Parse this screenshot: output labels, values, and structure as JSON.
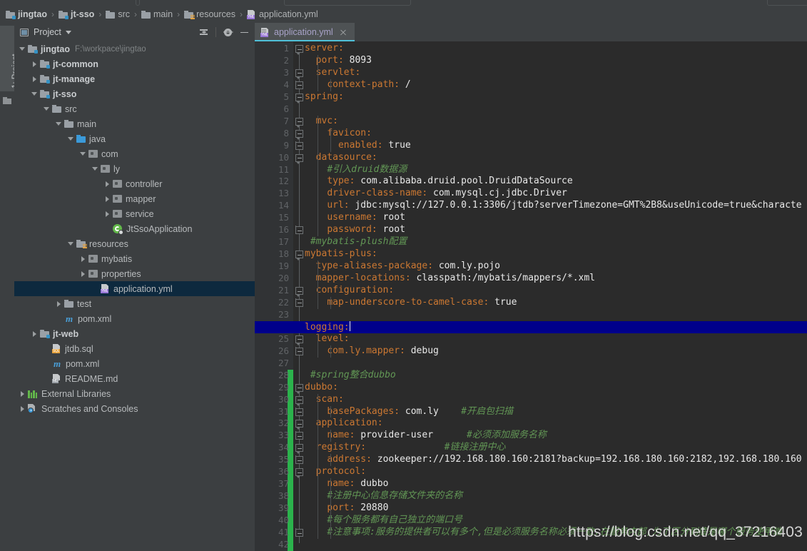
{
  "breadcrumb": {
    "items": [
      {
        "label": "jingtao",
        "icon": "module-folder-icon",
        "bold": true
      },
      {
        "label": "jt-sso",
        "icon": "module-folder-icon",
        "bold": true
      },
      {
        "label": "src",
        "icon": "folder-icon",
        "bold": false
      },
      {
        "label": "main",
        "icon": "folder-icon",
        "bold": false
      },
      {
        "label": "resources",
        "icon": "resources-folder-icon",
        "bold": false
      },
      {
        "label": "application.yml",
        "icon": "yml-file-icon",
        "bold": false
      }
    ],
    "separator": "›"
  },
  "left_strip": {
    "project_tab_label": "1: Project"
  },
  "project_panel": {
    "title": "Project",
    "icons": [
      "collapse-all-icon",
      "settings-gear-icon",
      "minimize-icon"
    ],
    "tree": [
      {
        "label": "jingtao",
        "path": "F:\\workpace\\jingtao",
        "depth": 0,
        "arrow": "down",
        "icon": "module-folder-icon",
        "bold": true,
        "selected": false
      },
      {
        "label": "jt-common",
        "path": "",
        "depth": 1,
        "arrow": "right",
        "icon": "module-folder-icon",
        "bold": true,
        "selected": false
      },
      {
        "label": "jt-manage",
        "path": "",
        "depth": 1,
        "arrow": "right",
        "icon": "module-folder-icon",
        "bold": true,
        "selected": false
      },
      {
        "label": "jt-sso",
        "path": "",
        "depth": 1,
        "arrow": "down",
        "icon": "module-folder-icon",
        "bold": true,
        "selected": false
      },
      {
        "label": "src",
        "path": "",
        "depth": 2,
        "arrow": "down",
        "icon": "folder-icon",
        "bold": false,
        "selected": false
      },
      {
        "label": "main",
        "path": "",
        "depth": 3,
        "arrow": "down",
        "icon": "folder-icon",
        "bold": false,
        "selected": false
      },
      {
        "label": "java",
        "path": "",
        "depth": 4,
        "arrow": "down",
        "icon": "source-folder-icon",
        "bold": false,
        "selected": false
      },
      {
        "label": "com",
        "path": "",
        "depth": 5,
        "arrow": "down",
        "icon": "package-icon",
        "bold": false,
        "selected": false
      },
      {
        "label": "ly",
        "path": "",
        "depth": 6,
        "arrow": "down",
        "icon": "package-icon",
        "bold": false,
        "selected": false
      },
      {
        "label": "controller",
        "path": "",
        "depth": 7,
        "arrow": "right",
        "icon": "package-icon",
        "bold": false,
        "selected": false
      },
      {
        "label": "mapper",
        "path": "",
        "depth": 7,
        "arrow": "right",
        "icon": "package-icon",
        "bold": false,
        "selected": false
      },
      {
        "label": "service",
        "path": "",
        "depth": 7,
        "arrow": "right",
        "icon": "package-icon",
        "bold": false,
        "selected": false
      },
      {
        "label": "JtSsoApplication",
        "path": "",
        "depth": 7,
        "arrow": "none",
        "icon": "spring-boot-class-icon",
        "bold": false,
        "selected": false
      },
      {
        "label": "resources",
        "path": "",
        "depth": 4,
        "arrow": "down",
        "icon": "resources-folder-icon",
        "bold": false,
        "selected": false
      },
      {
        "label": "mybatis",
        "path": "",
        "depth": 5,
        "arrow": "right",
        "icon": "package-icon",
        "bold": false,
        "selected": false
      },
      {
        "label": "properties",
        "path": "",
        "depth": 5,
        "arrow": "right",
        "icon": "package-icon",
        "bold": false,
        "selected": false
      },
      {
        "label": "application.yml",
        "path": "",
        "depth": 6,
        "arrow": "none",
        "icon": "yml-file-icon",
        "bold": false,
        "selected": true
      },
      {
        "label": "test",
        "path": "",
        "depth": 3,
        "arrow": "right",
        "icon": "folder-icon",
        "bold": false,
        "selected": false
      },
      {
        "label": "pom.xml",
        "path": "",
        "depth": 3,
        "arrow": "none",
        "icon": "maven-icon",
        "bold": false,
        "selected": false
      },
      {
        "label": "jt-web",
        "path": "",
        "depth": 1,
        "arrow": "right",
        "icon": "module-folder-icon",
        "bold": true,
        "selected": false
      },
      {
        "label": "jtdb.sql",
        "path": "",
        "depth": 2,
        "arrow": "none",
        "icon": "sql-file-icon",
        "bold": false,
        "selected": false
      },
      {
        "label": "pom.xml",
        "path": "",
        "depth": 2,
        "arrow": "none",
        "icon": "maven-icon",
        "bold": false,
        "selected": false
      },
      {
        "label": "README.md",
        "path": "",
        "depth": 2,
        "arrow": "none",
        "icon": "md-file-icon",
        "bold": false,
        "selected": false
      },
      {
        "label": "External Libraries",
        "path": "",
        "depth": 0,
        "arrow": "right",
        "icon": "libraries-icon",
        "bold": false,
        "selected": false
      },
      {
        "label": "Scratches and Consoles",
        "path": "",
        "depth": 0,
        "arrow": "right",
        "icon": "scratches-icon",
        "bold": false,
        "selected": false
      }
    ]
  },
  "editor": {
    "tab": {
      "label": "application.yml",
      "icon": "yml-file-icon",
      "close_icon": "close-icon",
      "active": true
    },
    "current_line": 24,
    "total_rendered_lines": 42,
    "colors": {
      "background": "#2b2b2b",
      "gutter": "#313335",
      "key": "#cc7832",
      "value": "#e8e8e8",
      "comment": "#629755",
      "current_line_bg": "#00008b",
      "vcs_added": "#2bb24c",
      "tab_underline": "#4fc0d8"
    },
    "vcs_marker_lines": [
      28,
      29,
      30,
      31,
      32,
      33,
      34,
      35,
      36,
      37,
      38,
      39,
      40,
      41,
      42
    ],
    "lines": [
      {
        "n": 1,
        "indent": 0,
        "fold": "top",
        "segs": [
          {
            "t": "server:",
            "c": "k"
          }
        ]
      },
      {
        "n": 2,
        "indent": 1,
        "fold": "none",
        "segs": [
          {
            "t": "port: ",
            "c": "k"
          },
          {
            "t": "8093",
            "c": "v"
          }
        ]
      },
      {
        "n": 3,
        "indent": 1,
        "fold": "top",
        "segs": [
          {
            "t": "servlet:",
            "c": "k"
          }
        ]
      },
      {
        "n": 4,
        "indent": 2,
        "fold": "end",
        "segs": [
          {
            "t": "context-path: ",
            "c": "k"
          },
          {
            "t": "/",
            "c": "v"
          }
        ]
      },
      {
        "n": 5,
        "indent": 0,
        "fold": "top",
        "segs": [
          {
            "t": "spring:",
            "c": "k"
          }
        ]
      },
      {
        "n": 6,
        "indent": 0,
        "fold": "none",
        "segs": []
      },
      {
        "n": 7,
        "indent": 1,
        "fold": "top",
        "segs": [
          {
            "t": "mvc:",
            "c": "k"
          }
        ]
      },
      {
        "n": 8,
        "indent": 2,
        "fold": "top",
        "segs": [
          {
            "t": "favicon:",
            "c": "k"
          }
        ]
      },
      {
        "n": 9,
        "indent": 3,
        "fold": "end",
        "segs": [
          {
            "t": "enabled: ",
            "c": "k"
          },
          {
            "t": "true",
            "c": "v"
          }
        ]
      },
      {
        "n": 10,
        "indent": 1,
        "fold": "top",
        "segs": [
          {
            "t": "datasource:",
            "c": "k"
          }
        ]
      },
      {
        "n": 11,
        "indent": 2,
        "fold": "none",
        "segs": [
          {
            "t": "#引入druid数据源",
            "c": "cm"
          }
        ]
      },
      {
        "n": 12,
        "indent": 2,
        "fold": "none",
        "segs": [
          {
            "t": "type: ",
            "c": "k"
          },
          {
            "t": "com.alibaba.druid.pool.DruidDataSource",
            "c": "v"
          }
        ]
      },
      {
        "n": 13,
        "indent": 2,
        "fold": "none",
        "segs": [
          {
            "t": "driver-class-name: ",
            "c": "k"
          },
          {
            "t": "com.mysql.cj.jdbc.Driver",
            "c": "v"
          }
        ]
      },
      {
        "n": 14,
        "indent": 2,
        "fold": "none",
        "segs": [
          {
            "t": "url: ",
            "c": "k"
          },
          {
            "t": "jdbc:mysql://127.0.0.1:3306/jtdb?serverTimezone=GMT%2B8&useUnicode=true&characte",
            "c": "v"
          }
        ]
      },
      {
        "n": 15,
        "indent": 2,
        "fold": "none",
        "segs": [
          {
            "t": "username: ",
            "c": "k"
          },
          {
            "t": "root",
            "c": "v"
          }
        ]
      },
      {
        "n": 16,
        "indent": 2,
        "fold": "end",
        "segs": [
          {
            "t": "password: ",
            "c": "k"
          },
          {
            "t": "root",
            "c": "v"
          }
        ]
      },
      {
        "n": 17,
        "indent": 0,
        "fold": "none",
        "segs": [
          {
            "t": " #mybatis-plush配置",
            "c": "cm"
          }
        ]
      },
      {
        "n": 18,
        "indent": 0,
        "fold": "top",
        "segs": [
          {
            "t": "mybatis-plus:",
            "c": "k"
          }
        ]
      },
      {
        "n": 19,
        "indent": 1,
        "fold": "none",
        "segs": [
          {
            "t": "type-aliases-package: ",
            "c": "k"
          },
          {
            "t": "com.ly.pojo",
            "c": "v"
          }
        ]
      },
      {
        "n": 20,
        "indent": 1,
        "fold": "none",
        "segs": [
          {
            "t": "mapper-locations: ",
            "c": "k"
          },
          {
            "t": "classpath:/mybatis/mappers/*.xml",
            "c": "v"
          }
        ]
      },
      {
        "n": 21,
        "indent": 1,
        "fold": "top",
        "segs": [
          {
            "t": "configuration:",
            "c": "k"
          }
        ]
      },
      {
        "n": 22,
        "indent": 2,
        "fold": "end",
        "segs": [
          {
            "t": "map-underscore-to-camel-case: ",
            "c": "k"
          },
          {
            "t": "true",
            "c": "v"
          }
        ]
      },
      {
        "n": 23,
        "indent": 0,
        "fold": "none",
        "segs": []
      },
      {
        "n": 24,
        "indent": 0,
        "fold": "top",
        "segs": [
          {
            "t": "logging:",
            "c": "k"
          }
        ],
        "caret": true
      },
      {
        "n": 25,
        "indent": 1,
        "fold": "top",
        "segs": [
          {
            "t": "level:",
            "c": "k"
          }
        ]
      },
      {
        "n": 26,
        "indent": 2,
        "fold": "end",
        "segs": [
          {
            "t": "com.ly.mapper: ",
            "c": "k"
          },
          {
            "t": "debug",
            "c": "v"
          }
        ]
      },
      {
        "n": 27,
        "indent": 0,
        "fold": "none",
        "segs": []
      },
      {
        "n": 28,
        "indent": 0,
        "fold": "none",
        "segs": [
          {
            "t": " #spring整合dubbo",
            "c": "cm"
          }
        ]
      },
      {
        "n": 29,
        "indent": 0,
        "fold": "top",
        "segs": [
          {
            "t": "dubbo:",
            "c": "k"
          }
        ]
      },
      {
        "n": 30,
        "indent": 1,
        "fold": "top",
        "segs": [
          {
            "t": "scan:",
            "c": "k"
          }
        ]
      },
      {
        "n": 31,
        "indent": 2,
        "fold": "end",
        "segs": [
          {
            "t": "basePackages: ",
            "c": "k"
          },
          {
            "t": "com.ly",
            "c": "v"
          },
          {
            "t": "    #开启包扫描",
            "c": "cm"
          }
        ]
      },
      {
        "n": 32,
        "indent": 1,
        "fold": "top",
        "segs": [
          {
            "t": "application:",
            "c": "k"
          }
        ]
      },
      {
        "n": 33,
        "indent": 2,
        "fold": "end",
        "segs": [
          {
            "t": "name: ",
            "c": "k"
          },
          {
            "t": "provider-user",
            "c": "v"
          },
          {
            "t": "      #必须添加服务名称",
            "c": "cm"
          }
        ]
      },
      {
        "n": 34,
        "indent": 1,
        "fold": "top",
        "segs": [
          {
            "t": "registry:",
            "c": "k"
          },
          {
            "t": "              #链接注册中心",
            "c": "cm"
          }
        ]
      },
      {
        "n": 35,
        "indent": 2,
        "fold": "end",
        "segs": [
          {
            "t": "address: ",
            "c": "k"
          },
          {
            "t": "zookeeper://192.168.180.160:2181?backup=192.168.180.160:2182,192.168.180.160",
            "c": "v"
          }
        ]
      },
      {
        "n": 36,
        "indent": 1,
        "fold": "top",
        "segs": [
          {
            "t": "protocol:",
            "c": "k"
          }
        ]
      },
      {
        "n": 37,
        "indent": 2,
        "fold": "none",
        "segs": [
          {
            "t": "name: ",
            "c": "k"
          },
          {
            "t": "dubbo",
            "c": "v"
          }
        ]
      },
      {
        "n": 38,
        "indent": 2,
        "fold": "none",
        "segs": [
          {
            "t": "#注册中心信息存储文件夹的名称",
            "c": "cm"
          }
        ]
      },
      {
        "n": 39,
        "indent": 2,
        "fold": "none",
        "segs": [
          {
            "t": "port: ",
            "c": "k"
          },
          {
            "t": "20880",
            "c": "v"
          }
        ]
      },
      {
        "n": 40,
        "indent": 2,
        "fold": "none",
        "segs": [
          {
            "t": "#每个服务都有自己独立的端口号",
            "c": "cm"
          }
        ]
      },
      {
        "n": 41,
        "indent": 2,
        "fold": "end",
        "segs": [
          {
            "t": "#注意事项:服务的提供者可以有多个,但是必须服务名称必须一致.在服务内部,为了区分到底是哪个服务使用端",
            "c": "cm"
          }
        ]
      },
      {
        "n": 42,
        "indent": 0,
        "fold": "none",
        "segs": []
      }
    ]
  },
  "watermark": {
    "text": "https://blog.csdn.net/qq_37216403"
  }
}
